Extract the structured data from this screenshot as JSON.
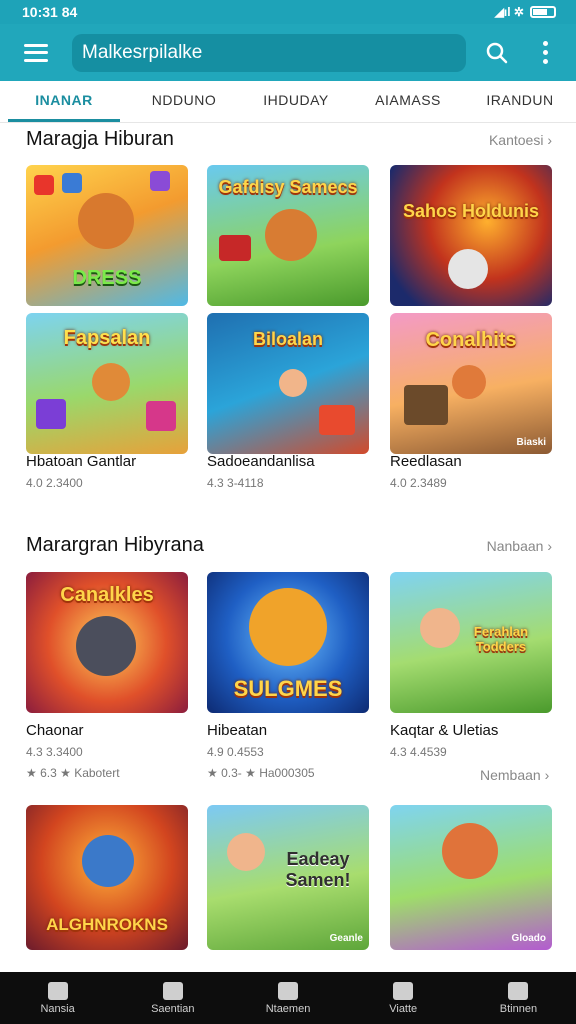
{
  "status": {
    "time": "10:31 84",
    "signal": "◢ıl ✲"
  },
  "appbar": {
    "search_value": "Malkesrpilalke"
  },
  "tabs": [
    "INANAR",
    "NDDUNO",
    "IHDUDAY",
    "AIAMASS",
    "IRANDUN"
  ],
  "section1": {
    "title": "Maragja Hiburan",
    "see_all": "Kantoesi ›",
    "cards": [
      {
        "art": "DRESS",
        "title": "Hbatoan Gantlar",
        "meta": "4.0 2.3400"
      },
      {
        "art": "Gafdisy Samecs",
        "title": "",
        "meta": ""
      },
      {
        "art": "Sahos Holdunis",
        "title": "",
        "meta": ""
      },
      {
        "art": "Fapsalan",
        "title": "Hbatoan Gantlar",
        "meta": "4.0 2.3400"
      },
      {
        "art": "Biloalan",
        "title": "Sadoeandanlisa",
        "meta": "4.3 3-4118"
      },
      {
        "art": "Conalhits",
        "title": "Reedlasan",
        "meta": "4.0 2.3489",
        "badge": "Biaski"
      }
    ]
  },
  "section2": {
    "title": "Marargran Hibyrana",
    "see_all": "Nanbaan ›",
    "cards": [
      {
        "art": "Canalkles",
        "title": "Chaonar",
        "meta": "4.3 3.3400",
        "rating": "★ 6.3   ★ Kabotert"
      },
      {
        "art": "SULGMES",
        "title": "Hibeatan",
        "meta": "4.9 0.4553",
        "rating": "★ 0.3-   ★ Ha000305"
      },
      {
        "art": "Ferahlan Todders",
        "title": "Kaqtar & Uletias",
        "meta": "4.3 4.4539",
        "rating": ""
      }
    ],
    "see_more": "Nembaan ›"
  },
  "section3": {
    "cards": [
      {
        "art": "ALGHNROKNS"
      },
      {
        "art": "Eadeay Samen!",
        "badge": "Geanle"
      },
      {
        "art": "",
        "badge": "Gloado"
      }
    ]
  },
  "bottom_nav": [
    "Nansia",
    "Saentian",
    "Ntaemen",
    "Viatte",
    "Btinnen"
  ]
}
